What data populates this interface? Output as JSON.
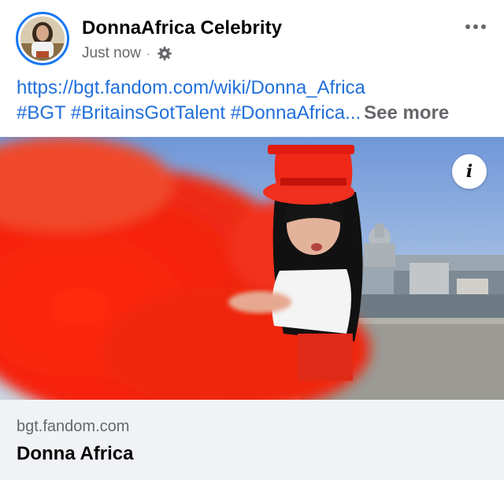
{
  "post": {
    "page_name": "DonnaAfrica Celebrity",
    "timestamp": "Just now",
    "separator": "·",
    "privacy_icon": "gear-icon",
    "more_icon": "more-options-icon"
  },
  "text": {
    "link": "https://bgt.fandom.com/wiki/Donna_Africa",
    "hashtags": [
      "#BGT",
      "#BritainsGotTalent",
      "#DonnaAfrica..."
    ],
    "see_more": "See more"
  },
  "media": {
    "info_label": "i"
  },
  "link_preview": {
    "domain": "bgt.fandom.com",
    "title": "Donna Africa"
  },
  "colors": {
    "accent": "#1877f2",
    "link": "#216fdb",
    "secondary_text": "#65676b",
    "preview_bg": "#f0f2f5"
  }
}
